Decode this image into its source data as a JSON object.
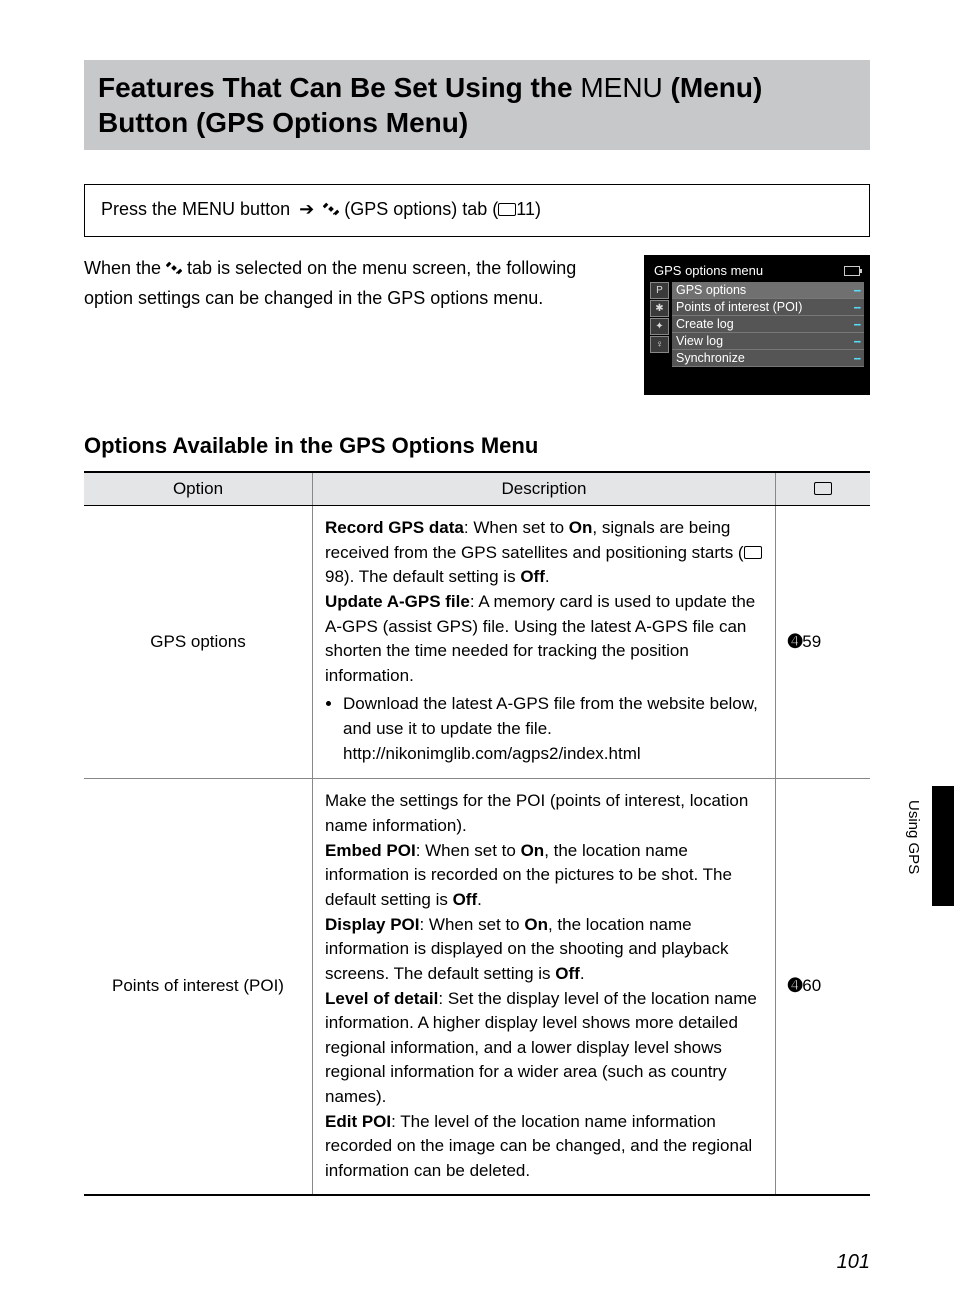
{
  "title_pre": "Features That Can Be Set Using the ",
  "title_menu": "MENU",
  "title_post": " (Menu) Button (GPS Options Menu)",
  "nav": {
    "press_the": "Press the ",
    "menu": "MENU",
    "button": " button ",
    "gps_tab": " (GPS options) tab (",
    "ref": "11)"
  },
  "intro_pre": "When the ",
  "intro_post": " tab is selected on the menu screen, the following option settings can be changed in the GPS options menu.",
  "lcd": {
    "title": "GPS options menu",
    "rows": [
      "GPS options",
      "Points of interest (POI)",
      "Create log",
      "View log",
      "Synchronize"
    ],
    "icons": [
      "P",
      "✱",
      "✦",
      "♀"
    ]
  },
  "subheading": "Options Available in the GPS Options Menu",
  "table": {
    "h1": "Option",
    "h2": "Description",
    "rows": [
      {
        "option": "GPS options",
        "ref": "59",
        "d1a": "Record GPS data",
        "d1b": ": When set to ",
        "d1c": "On",
        "d1d": ", signals are being received from the GPS satellites and positioning starts (",
        "d1e": "98). The default setting is ",
        "d1f": "Off",
        "d1g": ".",
        "d2a": "Update A-GPS file",
        "d2b": ": A memory card is used to update the A-GPS (assist GPS) file. Using the latest A-GPS file can shorten the time needed for tracking the position information.",
        "bullet1": "Download the latest A-GPS file from the website below, and use it to update the file.",
        "url": "http://nikonimglib.com/agps2/index.html"
      },
      {
        "option": "Points of interest (POI)",
        "ref": "60",
        "p1": "Make the settings for the POI (points of interest, location name information).",
        "e1a": "Embed POI",
        "e1b": ": When set to ",
        "e1c": "On",
        "e1d": ", the location name information is recorded on the pictures to be shot. The default setting is ",
        "e1e": "Off",
        "e1f": ".",
        "dp1a": "Display POI",
        "dp1b": ": When set to ",
        "dp1c": "On",
        "dp1d": ", the location name information is displayed on the shooting and playback screens. The default setting is ",
        "dp1e": "Off",
        "dp1f": ".",
        "l1a": "Level of detail",
        "l1b": ": Set the display level of the location name information. A higher display level shows more detailed regional information, and a lower display level shows regional information for a wider area (such as country names).",
        "ed1a": "Edit POI",
        "ed1b": ": The level of the location name information recorded on the image can be changed, and the regional information can be deleted."
      }
    ]
  },
  "side_label": "Using GPS",
  "page_number": "101"
}
